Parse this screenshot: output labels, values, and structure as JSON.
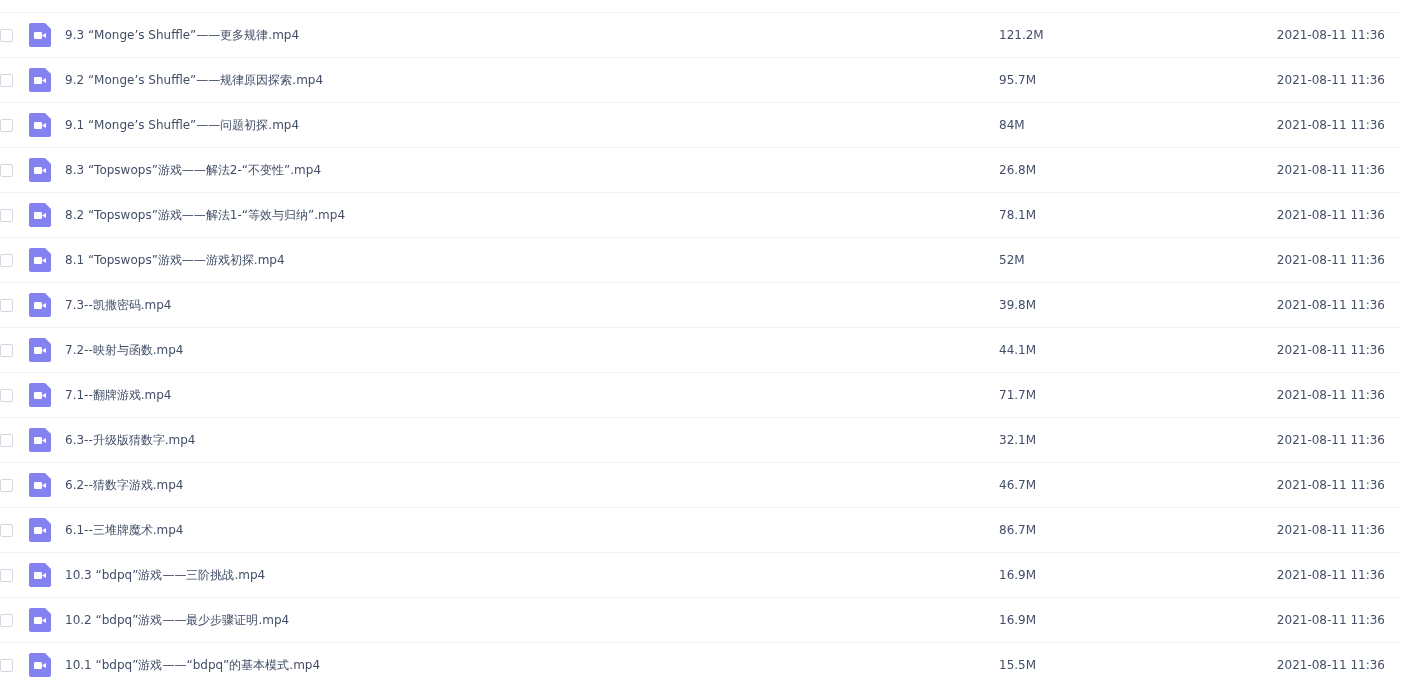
{
  "files": [
    {
      "name": "9.3 “Monge’s Shuffle”——更多规律.mp4",
      "size": "121.2M",
      "modified": "2021-08-11 11:36",
      "checked": false
    },
    {
      "name": "9.2 “Monge’s Shuffle”——规律原因探索.mp4",
      "size": "95.7M",
      "modified": "2021-08-11 11:36",
      "checked": false
    },
    {
      "name": "9.1 “Monge’s Shuffle”——问题初探.mp4",
      "size": "84M",
      "modified": "2021-08-11 11:36",
      "checked": false
    },
    {
      "name": "8.3 “Topswops”游戏——解法2-“不变性”.mp4",
      "size": "26.8M",
      "modified": "2021-08-11 11:36",
      "checked": false
    },
    {
      "name": "8.2 “Topswops”游戏——解法1-“等效与归纳”.mp4",
      "size": "78.1M",
      "modified": "2021-08-11 11:36",
      "checked": false
    },
    {
      "name": "8.1 “Topswops”游戏——游戏初探.mp4",
      "size": "52M",
      "modified": "2021-08-11 11:36",
      "checked": false
    },
    {
      "name": "7.3--凯撒密码.mp4",
      "size": "39.8M",
      "modified": "2021-08-11 11:36",
      "checked": false
    },
    {
      "name": "7.2--映射与函数.mp4",
      "size": "44.1M",
      "modified": "2021-08-11 11:36",
      "checked": false
    },
    {
      "name": "7.1--翻牌游戏.mp4",
      "size": "71.7M",
      "modified": "2021-08-11 11:36",
      "checked": false
    },
    {
      "name": "6.3--升级版猜数字.mp4",
      "size": "32.1M",
      "modified": "2021-08-11 11:36",
      "checked": false
    },
    {
      "name": "6.2--猜数字游戏.mp4",
      "size": "46.7M",
      "modified": "2021-08-11 11:36",
      "checked": false
    },
    {
      "name": "6.1--三堆牌魔术.mp4",
      "size": "86.7M",
      "modified": "2021-08-11 11:36",
      "checked": false
    },
    {
      "name": "10.3 “bdpq”游戏——三阶挑战.mp4",
      "size": "16.9M",
      "modified": "2021-08-11 11:36",
      "checked": false
    },
    {
      "name": "10.2 “bdpq”游戏——最少步骤证明.mp4",
      "size": "16.9M",
      "modified": "2021-08-11 11:36",
      "checked": false
    },
    {
      "name": "10.1 “bdpq”游戏——“bdpq”的基本模式.mp4",
      "size": "15.5M",
      "modified": "2021-08-11 11:36",
      "checked": false
    }
  ]
}
